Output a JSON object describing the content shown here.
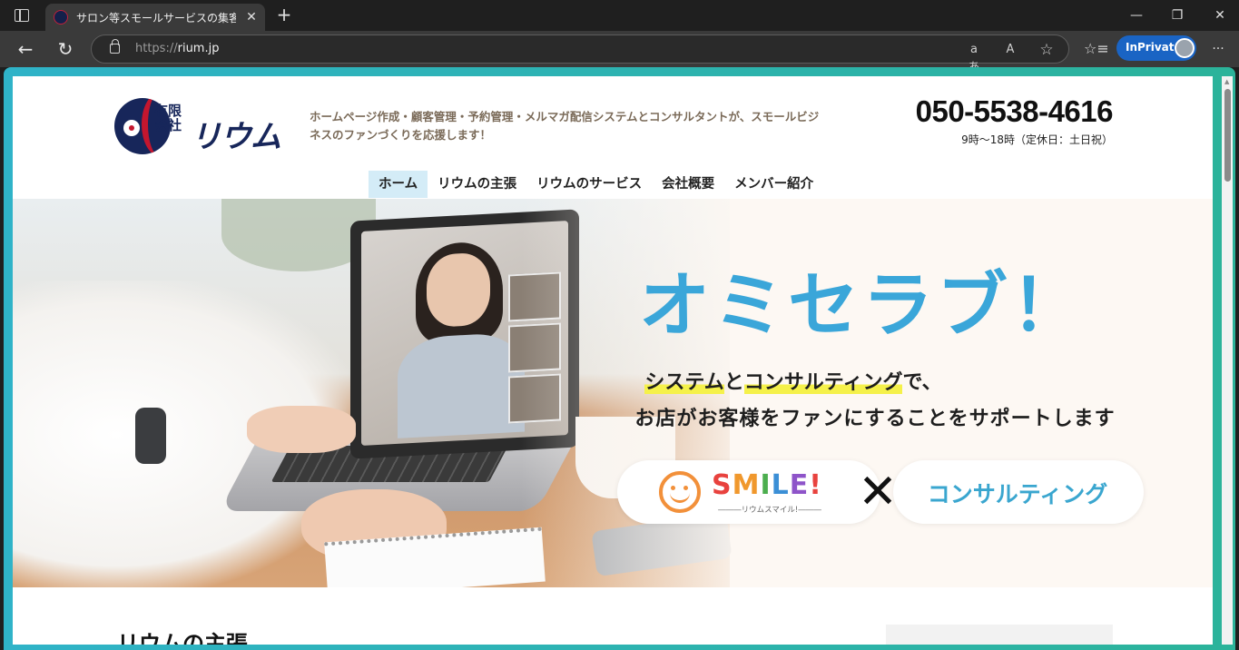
{
  "browser": {
    "tab": {
      "title": "サロン等スモールサービスの集客顧客フ"
    },
    "url": {
      "scheme": "https://",
      "host": "rium.jp"
    },
    "inprivate_label": "InPrivate",
    "icons": {
      "sidebar": "panel-icon",
      "close_tab": "close-icon",
      "new_tab": "plus-icon",
      "back": "back-arrow-icon",
      "refresh": "refresh-icon",
      "lock": "lock-icon",
      "translate": "translate-icon",
      "read_aloud": "read-aloud-icon",
      "favorite": "star-icon",
      "favorites_list": "favorites-icon",
      "more": "more-icon"
    },
    "glyphs": {
      "close": "✕",
      "new_tab": "+",
      "back": "←",
      "refresh": "↻",
      "translate": "aあ",
      "read_aloud": "A",
      "favorite": "☆",
      "favorites_list": "☆≡",
      "more": "···",
      "minimize": "—",
      "restore": "❐",
      "window_close": "✕"
    }
  },
  "site": {
    "logo": {
      "small": "有限\n会社",
      "name": "リウム"
    },
    "tagline": "ホームページ作成・顧客管理・予約管理・メルマガ配信システムとコンサルタントが、スモールビジネスのファンづくりを応援します！",
    "phone": "050-5538-4616",
    "hours": "9時〜18時（定休日：土日祝）",
    "nav": [
      {
        "label": "ホーム",
        "active": true
      },
      {
        "label": "リウムの主張",
        "active": false
      },
      {
        "label": "リウムのサービス",
        "active": false
      },
      {
        "label": "会社概要",
        "active": false
      },
      {
        "label": "メンバー紹介",
        "active": false
      }
    ],
    "hero": {
      "title": "オミセラブ！",
      "line1_part1": "システム",
      "line1_part2": "と",
      "line1_part3": "コンサルティング",
      "line1_part4": "で、",
      "line2": "お店がお客様をファンにすることをサポートします",
      "smile_word": "SMILE!",
      "smile_letter_colors": [
        "#e8423e",
        "#f0982d",
        "#4cae4f",
        "#3b8fd6",
        "#8e54c9",
        "#e8423e"
      ],
      "smile_sub": "―――リウムスマイル!―――",
      "times": "✕",
      "consult_label": "コンサルティング"
    },
    "section_heading": "リウムの主張"
  },
  "colors": {
    "accent": "#3aa6d9",
    "nav_active_bg": "#d4ecf7",
    "highlight": "#f5f14a",
    "brand_navy": "#17265a",
    "brand_red": "#c4162e",
    "inprivate": "#1a64c4"
  }
}
